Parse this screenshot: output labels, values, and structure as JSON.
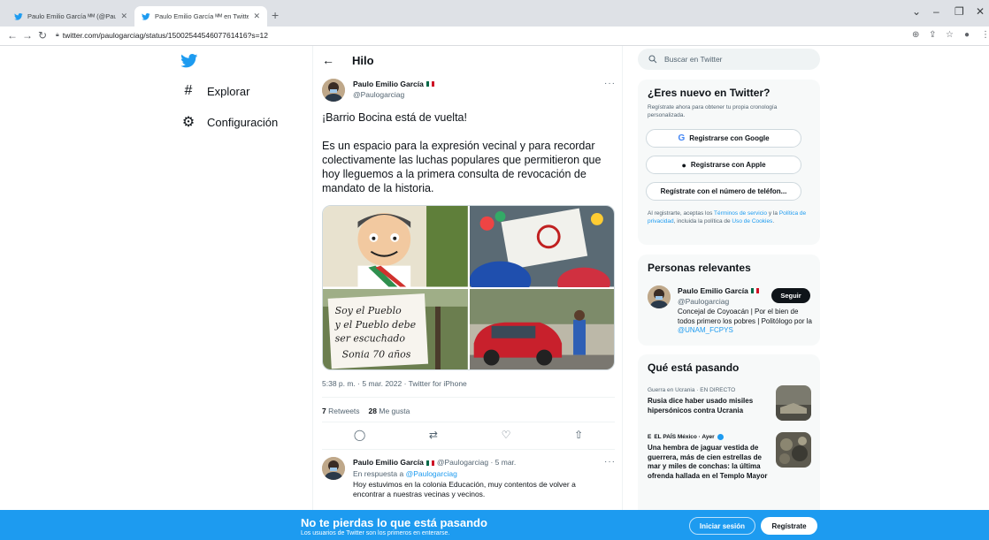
{
  "browser": {
    "tabs": [
      {
        "title": "Paulo Emilio García ᴹᴹ (@Paulog",
        "active": false
      },
      {
        "title": "Paulo Emilio García ᴹᴹ en Twitte",
        "active": true
      }
    ],
    "url": "twitter.com/paulogarciag/status/1500254454607761416?s=12"
  },
  "nav": {
    "items": [
      {
        "label": "Explorar",
        "icon": "hash-icon"
      },
      {
        "label": "Configuración",
        "icon": "gear-icon"
      }
    ]
  },
  "main": {
    "header_title": "Hilo",
    "tweet": {
      "author_name": "Paulo Emilio García",
      "author_handle": "@Paulogarciag",
      "text_line1": "¡Barrio Bocina está de vuelta!",
      "text_line2": "Es un espacio para la expresión vecinal y para recordar colectivamente las luchas populares que permitieron que hoy lleguemos a la primera consulta de revocación de mandato de la historia.",
      "timestamp": "5:38 p. m. · 5 mar. 2022 · Twitter for iPhone",
      "retweets_count": "7",
      "retweets_label": "Retweets",
      "likes_count": "28",
      "likes_label": "Me gusta",
      "sign_text": "Soy el Pueblo y el Pueblo debe ser escuchado Sonia 70 años"
    },
    "reply": {
      "author_name": "Paulo Emilio García",
      "meta": "@Paulogarciag · 5 mar.",
      "in_reply_prefix": "En respuesta a",
      "in_reply_handle": "@Paulogarciag",
      "text": "Hoy estuvimos en la colonia Educación, muy contentos de volver a encontrar a nuestras vecinas y vecinos."
    }
  },
  "sidebar": {
    "search_placeholder": "Buscar en Twitter",
    "new_card": {
      "title": "¿Eres nuevo en Twitter?",
      "subtitle": "Regístrate ahora para obtener tu propia cronología personalizada.",
      "google_button": "Registrarse con Google",
      "apple_button": "Registrarse con Apple",
      "phone_button": "Regístrate con el número de teléfon...",
      "legal_prefix": "Al registrarte, aceptas los",
      "terms_link": "Términos de servicio",
      "legal_y": "y la",
      "privacy_link": "Política de privacidad",
      "legal_cookies_prefix": ", incluida la política de",
      "cookies_link": "Uso de Cookies",
      "legal_end": "."
    },
    "relevant": {
      "title": "Personas relevantes",
      "name": "Paulo Emilio García",
      "handle": "@Paulogarciag",
      "follow_label": "Seguir",
      "bio": "Concejal de Coyoacán | Por el bien de todos primero los pobres | Politólogo por la",
      "bio_link": "@UNAM_FCPYS"
    },
    "trends": {
      "title": "Qué está pasando",
      "items": [
        {
          "meta": "Guerra en Ucrania · EN DIRECTO",
          "headline": "Rusia dice haber usado misiles hipersónicos contra Ucrania"
        },
        {
          "meta": "EL PAÍS México · Ayer",
          "headline": "Una hembra de jaguar vestida de guerrera, más de cien estrellas de mar y miles de conchas: la última ofrenda hallada en el Templo Mayor"
        }
      ]
    }
  },
  "bottom_bar": {
    "title": "No te pierdas lo que está pasando",
    "subtitle": "Los usuarios de Twitter son los primeros en enterarse.",
    "login_label": "Iniciar sesión",
    "signup_label": "Regístrate"
  },
  "colors": {
    "twitter_blue": "#1d9bf0",
    "text": "#0f1419",
    "muted": "#536471"
  }
}
